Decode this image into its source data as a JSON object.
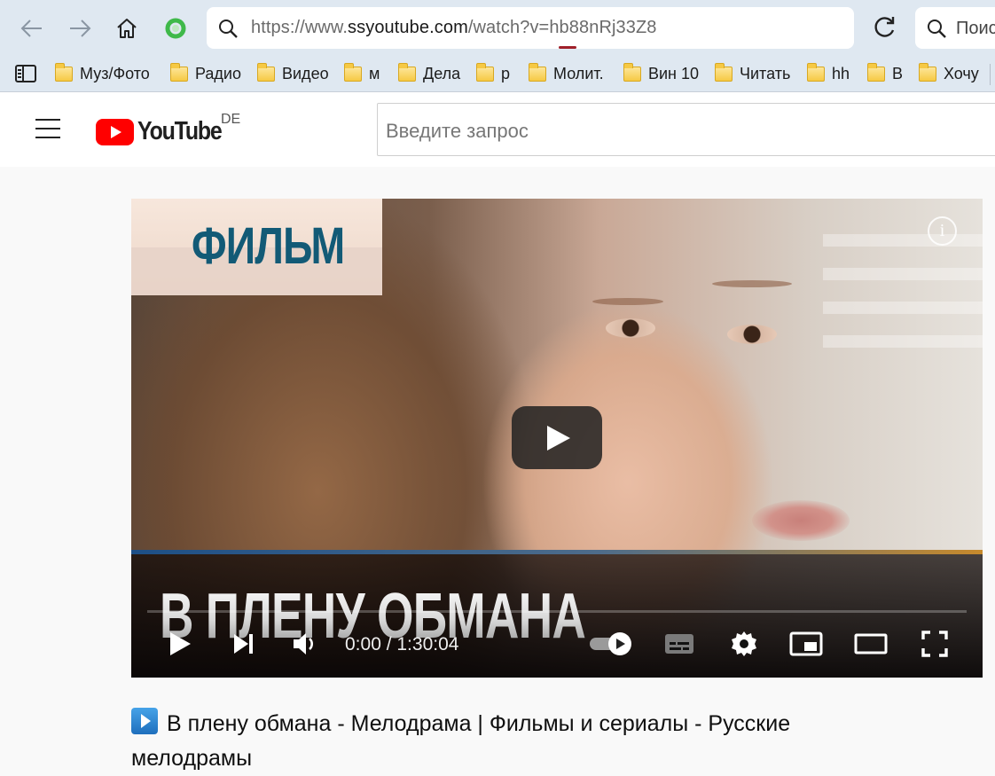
{
  "browser": {
    "url_prefix": "https://www.",
    "url_host": "ssyoutube.com",
    "url_path": "/watch?v=hb88nRj33Z8",
    "search_placeholder": "Поис"
  },
  "bookmarks": [
    {
      "label": "Муз/Фото"
    },
    {
      "label": "Радио"
    },
    {
      "label": "Видео"
    },
    {
      "label": "м"
    },
    {
      "label": "Дела"
    },
    {
      "label": "р"
    },
    {
      "label": "Молит."
    },
    {
      "label": "Вин 10"
    },
    {
      "label": "Читать"
    },
    {
      "label": "hh"
    },
    {
      "label": "В"
    },
    {
      "label": "Хочу"
    }
  ],
  "youtube": {
    "logo_text": "YouTube",
    "region": "DE",
    "search_placeholder": "Введите запрос"
  },
  "player": {
    "overlay_badge": "ФИЛЬМ",
    "overlay_title": "В ПЛЕНУ ОБМАНА",
    "info_symbol": "i",
    "time": "0:00 / 1:30:04",
    "progress": 0,
    "autoplay": "on"
  },
  "video": {
    "title": "В плену обмана - Мелодрама | Фильмы и сериалы - Русские мелодрамы"
  },
  "colors": {
    "brand_red": "#ff0000",
    "badge_text": "#125a76",
    "chrome_bg": "#dfe8f1"
  }
}
